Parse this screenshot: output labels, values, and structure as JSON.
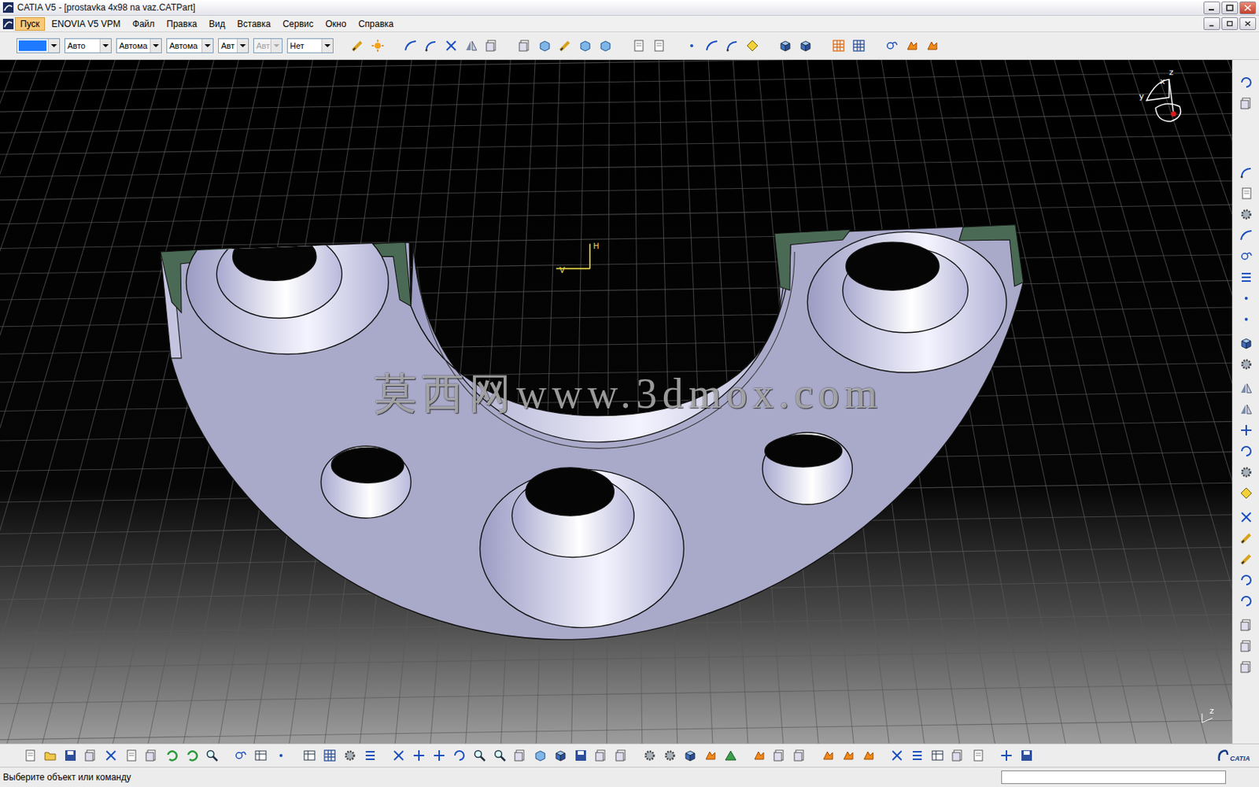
{
  "window": {
    "title": "CATIA V5 - [prostavka 4x98 na vaz.CATPart]"
  },
  "menu": [
    {
      "label": "Пуск",
      "selected": true
    },
    {
      "label": "ENOVIA V5 VPM",
      "selected": false
    },
    {
      "label": "Файл",
      "selected": false
    },
    {
      "label": "Правка",
      "selected": false
    },
    {
      "label": "Вид",
      "selected": false
    },
    {
      "label": "Вставка",
      "selected": false
    },
    {
      "label": "Сервис",
      "selected": false
    },
    {
      "label": "Окно",
      "selected": false
    },
    {
      "label": "Справка",
      "selected": false
    }
  ],
  "toolbar": {
    "dropdowns": [
      {
        "kind": "color",
        "value": "",
        "color": "#1e7bff",
        "disabled": false
      },
      {
        "kind": "text",
        "value": "Авто",
        "disabled": false
      },
      {
        "kind": "text",
        "value": "Автома",
        "disabled": false
      },
      {
        "kind": "text",
        "value": "Автома",
        "disabled": false
      },
      {
        "kind": "text",
        "value": "Авт",
        "disabled": false
      },
      {
        "kind": "text",
        "value": "Авт",
        "disabled": true
      },
      {
        "kind": "text",
        "value": "Нет",
        "disabled": false
      }
    ]
  },
  "viewport": {
    "watermark": "莫西网www.3dmox.com",
    "sketch_axes": {
      "h": "H",
      "v": "V"
    },
    "compass_axes": {
      "x": "x",
      "y": "y",
      "z": "z"
    },
    "corner_axis": "z"
  },
  "logo": "CATIA",
  "status_bar": {
    "message": "Выберите объект или команду",
    "field": ""
  }
}
